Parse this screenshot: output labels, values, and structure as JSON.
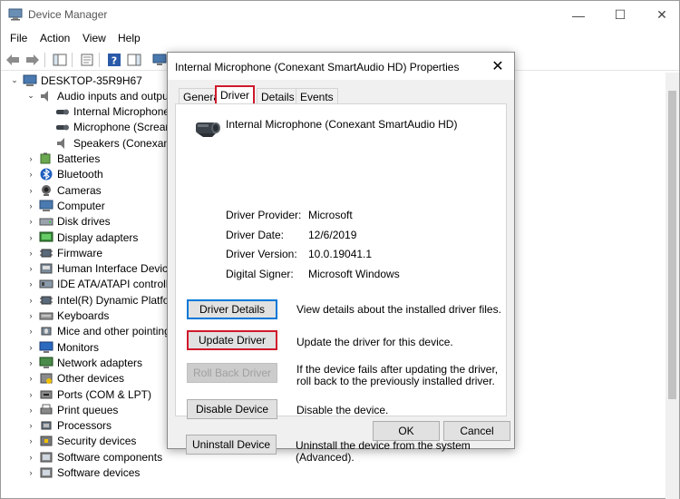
{
  "window": {
    "title": "Device Manager",
    "minimize_glyph": "—",
    "maximize_glyph": "☐",
    "close_glyph": "✕"
  },
  "menu": [
    "File",
    "Action",
    "View",
    "Help"
  ],
  "tree": {
    "root": "DESKTOP-35R9H67",
    "items": [
      {
        "label": "Audio inputs and outputs",
        "level": 1,
        "expanded": true,
        "icon": "speaker-icon"
      },
      {
        "label": "Internal Microphone (Conexant SmartAudio HD)",
        "level": 2,
        "icon": "microphone-icon"
      },
      {
        "label": "Microphone (Scream)",
        "level": 2,
        "icon": "microphone-icon"
      },
      {
        "label": "Speakers (Conexant SmartAudio HD)",
        "level": 2,
        "icon": "speaker-icon"
      },
      {
        "label": "Batteries",
        "level": 1,
        "icon": "battery-icon"
      },
      {
        "label": "Bluetooth",
        "level": 1,
        "icon": "bluetooth-icon"
      },
      {
        "label": "Cameras",
        "level": 1,
        "icon": "camera-icon"
      },
      {
        "label": "Computer",
        "level": 1,
        "icon": "computer-icon"
      },
      {
        "label": "Disk drives",
        "level": 1,
        "icon": "disk-icon"
      },
      {
        "label": "Display adapters",
        "level": 1,
        "icon": "display-icon"
      },
      {
        "label": "Firmware",
        "level": 1,
        "icon": "chip-icon"
      },
      {
        "label": "Human Interface Devices",
        "level": 1,
        "icon": "hid-icon"
      },
      {
        "label": "IDE ATA/ATAPI controllers",
        "level": 1,
        "icon": "controller-icon"
      },
      {
        "label": "Intel(R) Dynamic Platform",
        "level": 1,
        "icon": "chip-icon"
      },
      {
        "label": "Keyboards",
        "level": 1,
        "icon": "keyboard-icon"
      },
      {
        "label": "Mice and other pointing",
        "level": 1,
        "icon": "mouse-icon"
      },
      {
        "label": "Monitors",
        "level": 1,
        "icon": "monitor-icon"
      },
      {
        "label": "Network adapters",
        "level": 1,
        "icon": "network-icon"
      },
      {
        "label": "Other devices",
        "level": 1,
        "icon": "unknown-device-icon"
      },
      {
        "label": "Ports (COM & LPT)",
        "level": 1,
        "icon": "port-icon"
      },
      {
        "label": "Print queues",
        "level": 1,
        "icon": "printer-icon"
      },
      {
        "label": "Processors",
        "level": 1,
        "icon": "processor-icon"
      },
      {
        "label": "Security devices",
        "level": 1,
        "icon": "security-icon"
      },
      {
        "label": "Software components",
        "level": 1,
        "icon": "component-icon"
      },
      {
        "label": "Software devices",
        "level": 1,
        "icon": "component-icon"
      }
    ]
  },
  "dialog": {
    "title": "Internal Microphone (Conexant SmartAudio HD) Properties",
    "close_glyph": "✕",
    "tabs": [
      "General",
      "Driver",
      "Details",
      "Events"
    ],
    "active_tab": "Driver",
    "device_name": "Internal Microphone (Conexant SmartAudio HD)",
    "properties": [
      {
        "label": "Driver Provider:",
        "value": "Microsoft"
      },
      {
        "label": "Driver Date:",
        "value": "12/6/2019"
      },
      {
        "label": "Driver Version:",
        "value": "10.0.19041.1"
      },
      {
        "label": "Digital Signer:",
        "value": "Microsoft Windows"
      }
    ],
    "actions": [
      {
        "label": "Driver Details",
        "desc": "View details about the installed driver files."
      },
      {
        "label": "Update Driver",
        "desc": "Update the driver for this device."
      },
      {
        "label": "Roll Back Driver",
        "desc": "If the device fails after updating the driver, roll back to the previously installed driver."
      },
      {
        "label": "Disable Device",
        "desc": "Disable the device."
      },
      {
        "label": "Uninstall Device",
        "desc": "Uninstall the device from the system (Advanced)."
      }
    ],
    "ok_label": "OK",
    "cancel_label": "Cancel"
  }
}
